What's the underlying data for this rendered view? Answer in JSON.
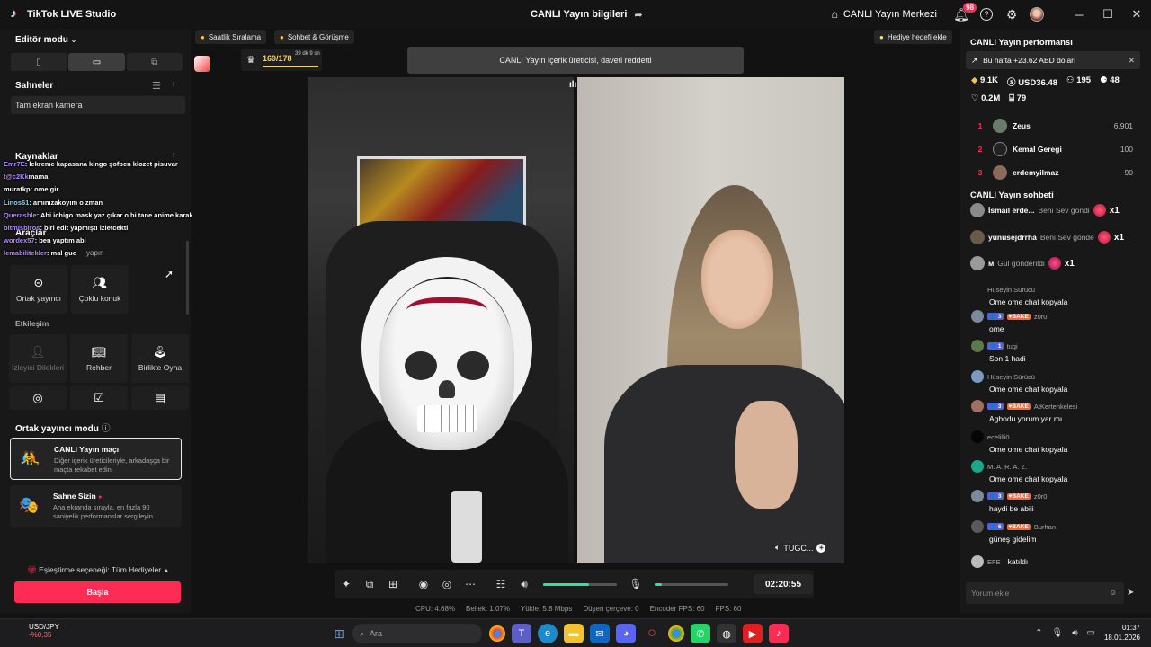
{
  "titlebar": {
    "app_name": "TikTok LIVE Studio",
    "center_title": "CANLI Yayın bilgileri",
    "live_center": "CANLI Yayın Merkezi",
    "notif_count": "98"
  },
  "left": {
    "editor_mode": "Editör modu",
    "scenes_title": "Sahneler",
    "scene_item": "Tam ekran kamera",
    "sources_title": "Kaynaklar",
    "tools_title": "Araçlar",
    "tools_sub": "yapın",
    "tools": [
      {
        "label": "Ortak yayıncı"
      },
      {
        "label": "Çoklu konuk"
      }
    ],
    "interaction_title": "Etkileşim",
    "interaction_tools": [
      {
        "label": "İzleyici Dilekleri"
      },
      {
        "label": "Rehber"
      },
      {
        "label": "Birlikte Oyna"
      }
    ],
    "coop_title": "Ortak yayıncı modu",
    "coop_cards": [
      {
        "title": "CANLI Yayın maçı",
        "desc": "Diğer içerik üreticileriyle, arkadaşça bir maçta rekabet edin."
      },
      {
        "title": "Sahne Sizin",
        "desc": "Ana ekranda sırayla, en fazla 90 saniyelik performanslar sergileyin."
      }
    ],
    "pair_option": "Eşleştirme seçeneği: Tüm Hediyeler",
    "start_button": "Başla"
  },
  "chat_overlay": [
    {
      "user": "Emr7E",
      "msg": ": lekreme kapasana kingo şofben klozet pisuvar"
    },
    {
      "user": "t@c2Kk",
      "msg": "mama"
    },
    {
      "user": "muratkp",
      "msg": ": ome gir"
    },
    {
      "user": "Linos61",
      "msg": ": amınızakoyım o zman"
    },
    {
      "user": "Querasble",
      "msg": ": Abi ichigo mask yaz çıkar o bi tane anime karakteri maskesi"
    },
    {
      "user": "bitmisbiros",
      "msg": ": biri edit yapmıştı izletcekti"
    },
    {
      "user": "wordex57",
      "msg": ": ben yaptım abi"
    },
    {
      "user": "lemabilitekler",
      "msg": ": mal gue"
    }
  ],
  "center": {
    "pill_hourly": "Saatlik Sıralama",
    "pill_chat": "Sohbet & Görüşme",
    "pill_gift_goal": "Hediye hedefi ekle",
    "notice": "CANLI Yayın içerik üreticisi, daveti reddetti",
    "score": "169/178",
    "score_time": "39 dk 9 sn",
    "guest_label": "TUGC...",
    "timer": "02:20:55",
    "volume_level": 0.62,
    "mic_level": 0.1
  },
  "stats": {
    "cpu": "CPU: 4.68%",
    "memory": "Bellek: 1.07%",
    "upload": "Yükle: 5.8 Mbps",
    "dropped": "Düşen çerçeve: 0",
    "encoder_fps": "Encoder FPS: 60",
    "fps": "FPS: 60"
  },
  "right": {
    "perf_title": "CANLI Yayın performansı",
    "week_text": "Bu hafta +23.62 ABD doları",
    "metrics_row1": [
      "9.1K",
      "USD36.48",
      "195",
      "48"
    ],
    "metrics_row2": [
      "0.2M",
      "79"
    ],
    "ranking": [
      {
        "no": "1",
        "name": "Zeus",
        "score": "6.901"
      },
      {
        "no": "2",
        "name": "Kemal Geregi",
        "score": "100"
      },
      {
        "no": "3",
        "name": "erdemyilmaz",
        "score": "90"
      }
    ],
    "chat_title": "CANLI Yayın sohbeti",
    "gifts": [
      {
        "user": "İsmail erde...",
        "text": "Beni Sev göndi",
        "count": "x1"
      },
      {
        "user": "yunusejdrrha",
        "text": "Beni Sev gönde",
        "count": "x1"
      },
      {
        "user": "ᴍ",
        "text": "Gül gönderildi",
        "count": "x1"
      }
    ],
    "messages": [
      {
        "user": "Hüseyin Sürücü",
        "level": "",
        "fan": "",
        "text": "Ome ome chat kopyala"
      },
      {
        "user": "z0r0.",
        "level": "3",
        "fan": "BAKE",
        "text": "ome"
      },
      {
        "user": "tugi",
        "level": "1",
        "fan": "",
        "text": "Son 1 hadi"
      },
      {
        "user": "Hüseyin Sürücü",
        "level": "",
        "fan": "",
        "text": "Ome ome chat kopyala"
      },
      {
        "user": "AtKertenkelesi",
        "level": "3",
        "fan": "BAKE",
        "text": "Agbodu yorum yar mı"
      },
      {
        "user": "ecelilli0",
        "level": "",
        "fan": "",
        "text": "Ome ome chat kopyala"
      },
      {
        "user": "M. A. R. A. Z.",
        "level": "",
        "fan": "",
        "text": "Ome ome chat kopyala"
      },
      {
        "user": "z0r0.",
        "level": "3",
        "fan": "BAKE",
        "text": "haydi be abiii"
      },
      {
        "user": "Burhan",
        "level": "6",
        "fan": "BAKE",
        "text": "güneş gidelim"
      },
      {
        "user": "EFE",
        "level": "",
        "fan": "",
        "text": "katıldı"
      }
    ],
    "comment_placeholder": "Yorum ekle"
  },
  "taskbar": {
    "stock_name": "USD/JPY",
    "stock_change": "-%0,35",
    "search_placeholder": "Ara",
    "time": "01:37",
    "date": "18.01.2026"
  }
}
